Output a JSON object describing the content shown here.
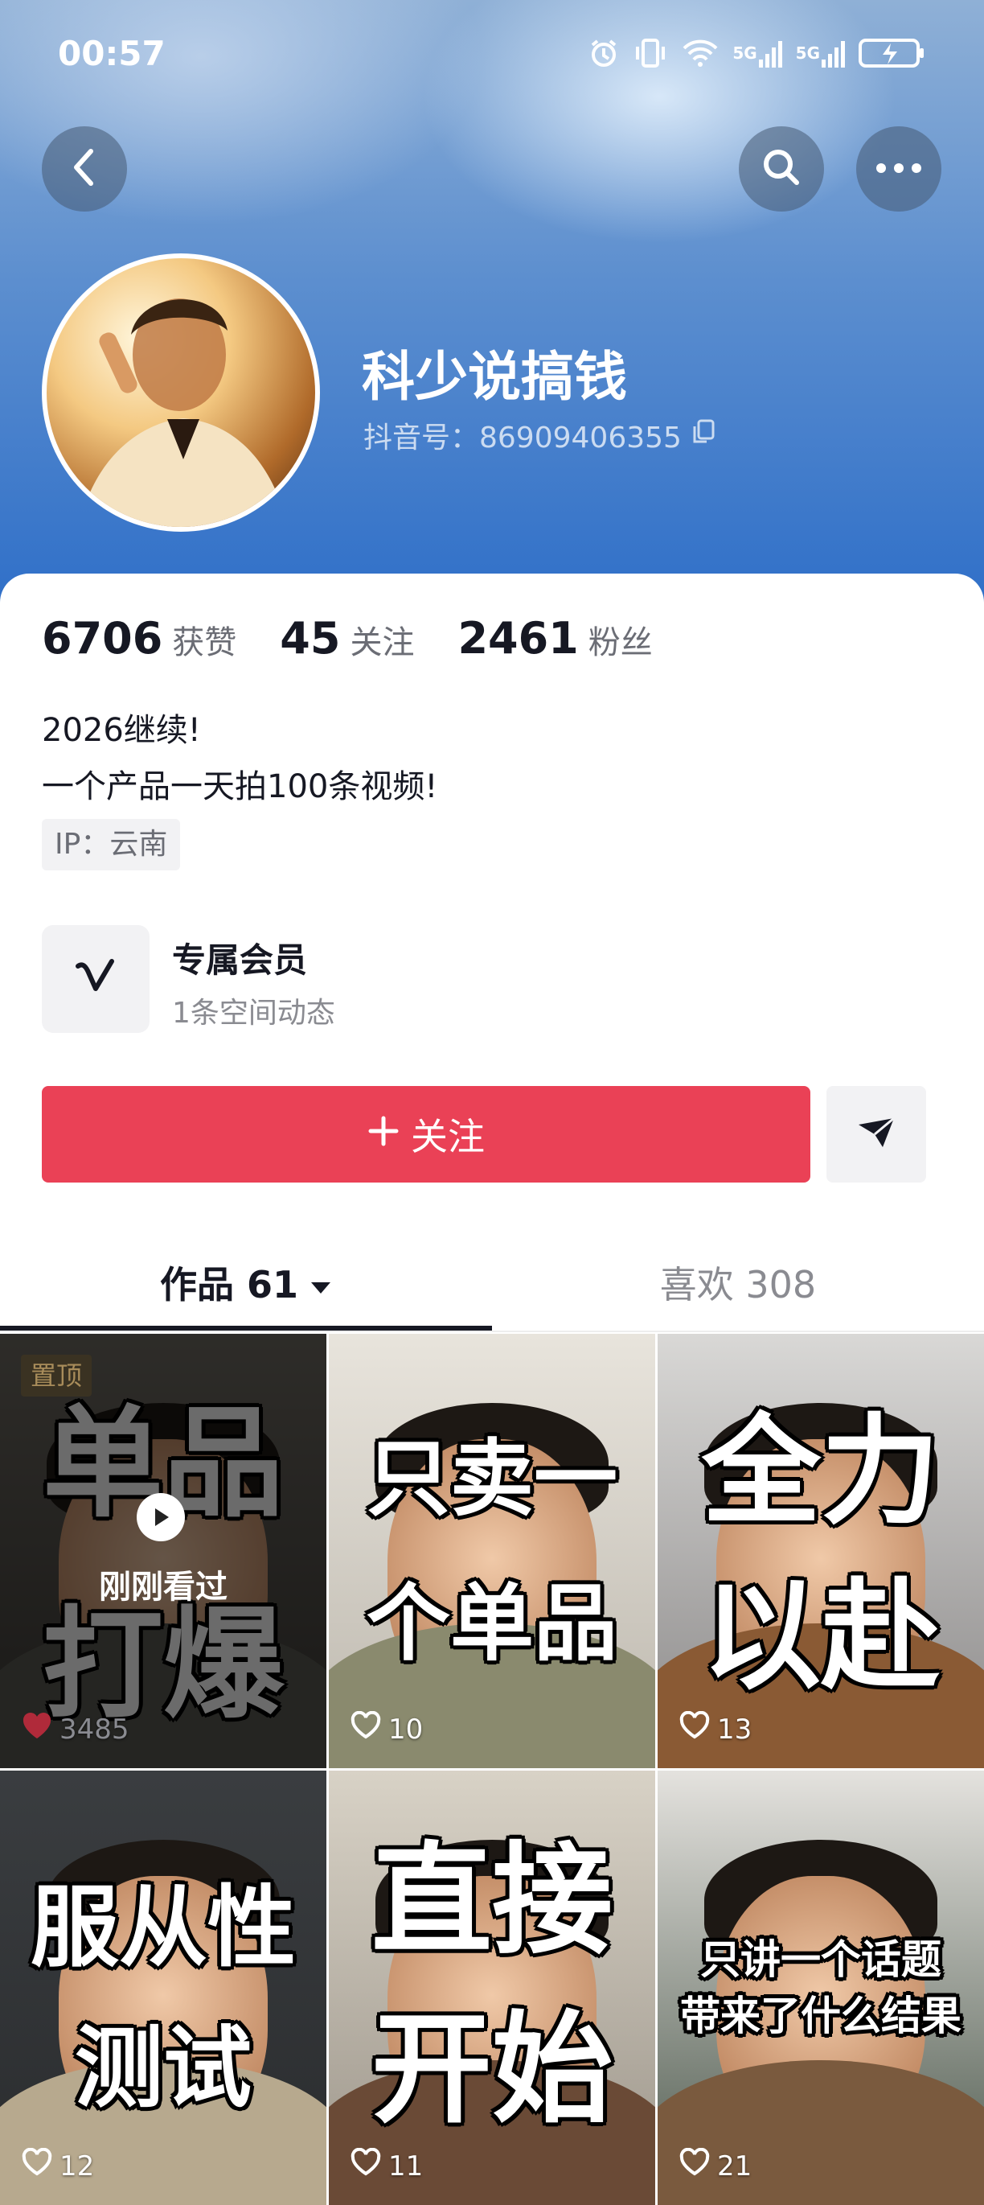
{
  "status_bar": {
    "time": "00:57",
    "net1": "5G",
    "net2": "5G"
  },
  "profile": {
    "name": "科少说搞钱",
    "douyin_id": "抖音号：86909406355",
    "stats": [
      {
        "num": "6706",
        "label": "获赞"
      },
      {
        "num": "45",
        "label": "关注"
      },
      {
        "num": "2461",
        "label": "粉丝"
      }
    ],
    "bio_line1": "2026继续!",
    "bio_line2": "一个产品一天拍100条视频!",
    "ip": "IP：云南"
  },
  "member": {
    "title": "专属会员",
    "subtitle": "1条空间动态"
  },
  "actions": {
    "follow_label": "关注"
  },
  "tabs": {
    "works": "作品 61",
    "likes": "喜欢 308"
  },
  "videos": [
    {
      "cap1": "单品",
      "cap2": "打爆",
      "likes": "3485",
      "pinned": "置顶",
      "watched": "刚刚看过"
    },
    {
      "cap1": "只卖一",
      "cap2": "个单品",
      "likes": "10"
    },
    {
      "cap1": "全力",
      "cap2": "以赴",
      "likes": "13"
    },
    {
      "cap1": "服从性",
      "cap2": "测试",
      "likes": "12"
    },
    {
      "cap1": "直接",
      "cap2": "开始",
      "likes": "11"
    },
    {
      "cap1": "只讲一个话题",
      "cap2": "带来了什么结果",
      "likes": "21"
    }
  ],
  "colors": {
    "accent": "#ea4156",
    "header": "#2f6fc8"
  }
}
